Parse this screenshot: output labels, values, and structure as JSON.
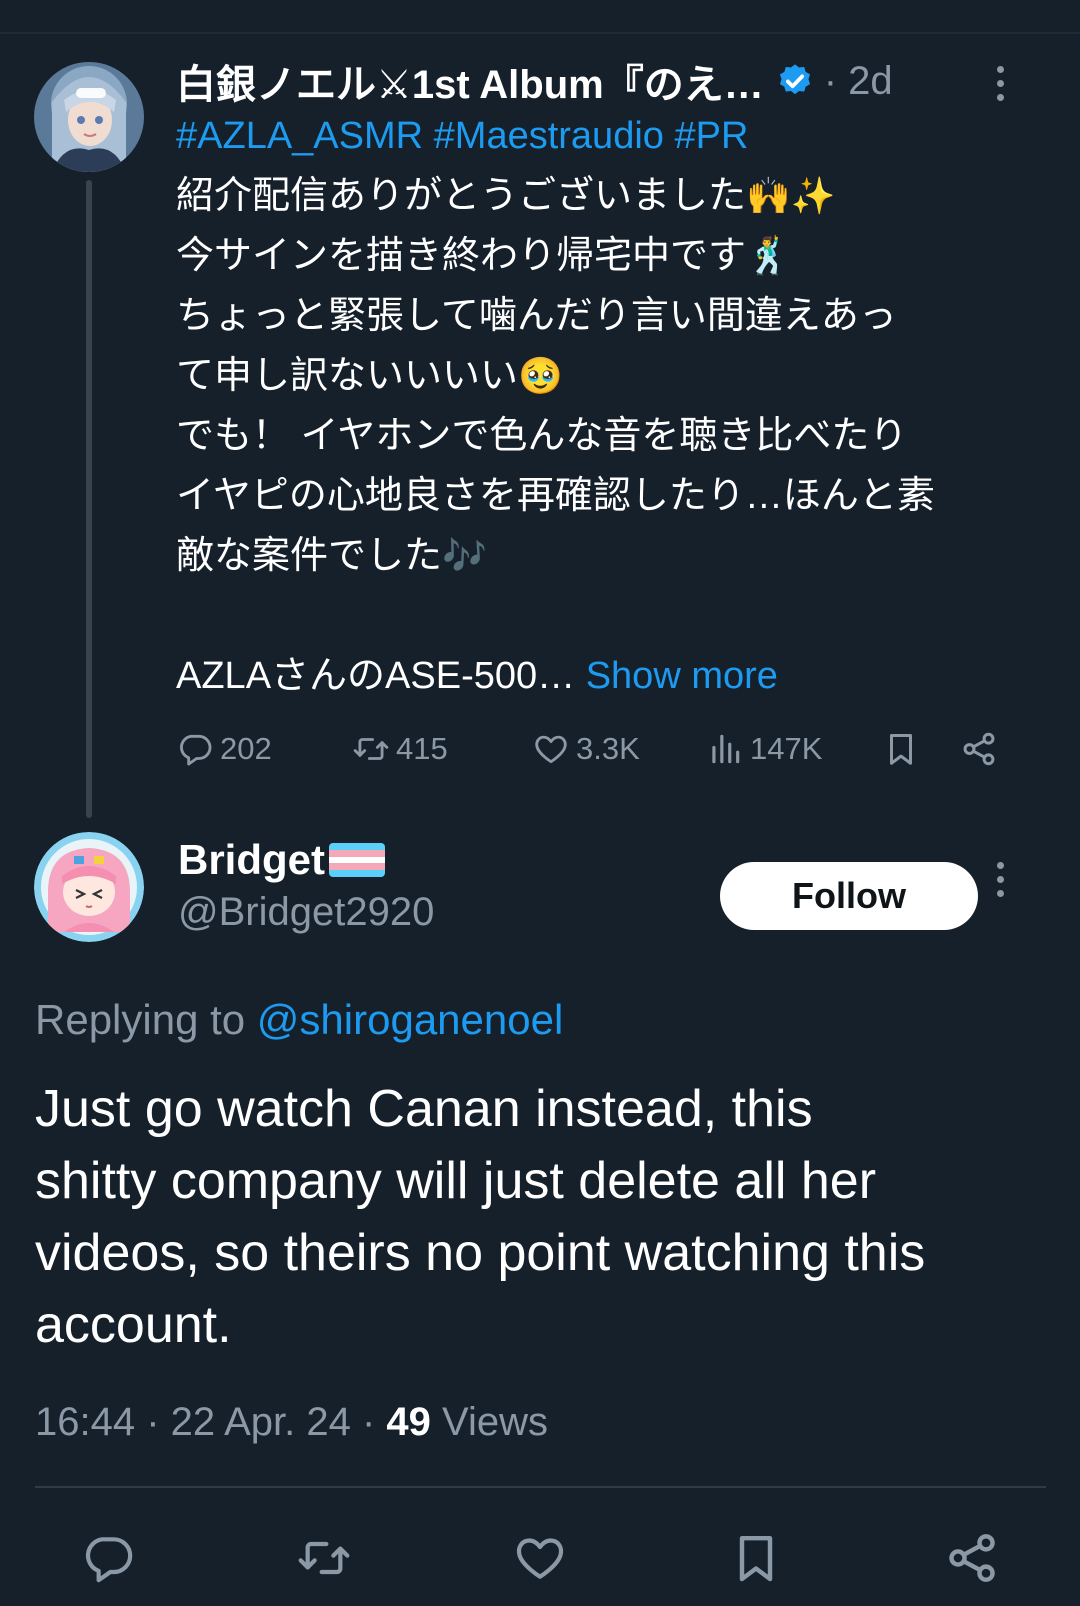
{
  "parent_tweet": {
    "author_name": "白銀ノエル⚔1st Album『のえ…",
    "time_ago": "· 2d",
    "hashtags": [
      "#AZLA_ASMR",
      "#Maestraudio",
      "#PR"
    ],
    "lines": [
      "紹介配信ありがとうございました",
      "今サインを描き終わり帰宅中です",
      "ちょっと緊張して噛んだり言い間違えあっ",
      "て申し訳ないいいい",
      "でも！ イヤホンで色んな音を聴き比べたり",
      "イヤピの心地良さを再確認したり…ほんと素",
      "敵な案件でした"
    ],
    "emojis": {
      "line1": "🙌✨",
      "line2": "🕺",
      "line4": "🥹",
      "line7": "🎶"
    },
    "last_line": "AZLAさんのASE-500…",
    "show_more_label": "Show more",
    "stats": {
      "replies": "202",
      "reposts": "415",
      "likes": "3.3K",
      "views": "147K"
    }
  },
  "reply": {
    "author_name": "Bridget",
    "handle": "@Bridget2920",
    "follow_label": "Follow",
    "replying_prefix": "Replying to",
    "replying_to": "@shiroganenoel",
    "text_lines": [
      "Just go watch Canan instead, this",
      "shitty company will just delete all her",
      "videos, so theirs no point watching this",
      "account."
    ],
    "time": "16:44",
    "date": "22 Apr. 24",
    "views_count": "49",
    "views_label": "Views"
  },
  "colors": {
    "background": "#15202b",
    "accent": "#1d9bf0",
    "muted": "#8b98a5",
    "divider": "#2f3b47"
  },
  "icons": {
    "parent_actions": [
      "reply-icon",
      "repost-icon",
      "like-icon",
      "views-icon",
      "bookmark-icon",
      "share-icon"
    ],
    "bottom_actions": [
      "reply-icon",
      "repost-icon",
      "like-icon",
      "bookmark-icon",
      "share-icon"
    ]
  }
}
